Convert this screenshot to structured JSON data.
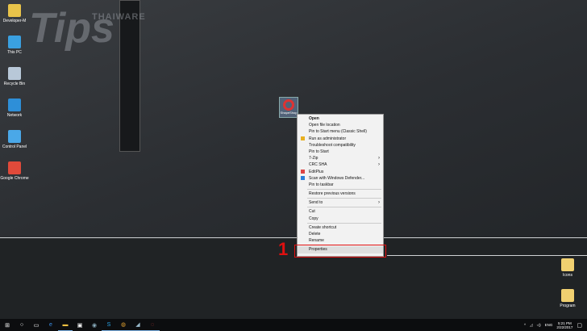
{
  "watermark": {
    "brand": "THAIWARE",
    "word": "Tips"
  },
  "desktop_icons": [
    {
      "label": "Developer-M",
      "color": "#e8c34a"
    },
    {
      "label": "This PC",
      "color": "#3aa0e0"
    },
    {
      "label": "Recycle Bin",
      "color": "#b8c8d8"
    },
    {
      "label": "Network",
      "color": "#2e8fd8"
    },
    {
      "label": "Control Panel",
      "color": "#4aa8e8"
    },
    {
      "label": "Google Chrome",
      "color": "#e04a3a"
    }
  ],
  "right_icons": [
    {
      "label": "Icons"
    },
    {
      "label": "Program"
    }
  ],
  "shortcut": {
    "label": "ShapeShop"
  },
  "menu": {
    "groups": [
      [
        {
          "label": "Open",
          "bold": true
        },
        {
          "label": "Open file location"
        },
        {
          "label": "Pin to Start menu (Classic Shell)"
        },
        {
          "label": "Run as administrator",
          "icon": "shield-icon"
        },
        {
          "label": "Troubleshoot compatibility"
        },
        {
          "label": "Pin to Start"
        },
        {
          "label": "7-Zip",
          "sub": true
        },
        {
          "label": "CRC SHA",
          "sub": true
        },
        {
          "label": "EditPlus",
          "icon": "editplus-icon"
        },
        {
          "label": "Scan with Windows Defender...",
          "icon": "defender-icon"
        },
        {
          "label": "Pin to taskbar"
        }
      ],
      [
        {
          "label": "Restore previous versions"
        }
      ],
      [
        {
          "label": "Send to",
          "sub": true
        }
      ],
      [
        {
          "label": "Cut"
        },
        {
          "label": "Copy"
        }
      ],
      [
        {
          "label": "Create shortcut"
        },
        {
          "label": "Delete"
        },
        {
          "label": "Rename"
        }
      ],
      [
        {
          "label": "Properties",
          "selected": true
        }
      ]
    ]
  },
  "annotation": {
    "number": "1",
    "color": "#e01010"
  },
  "taskbar": {
    "apps": [
      "start",
      "search",
      "task-view",
      "edge",
      "file-explorer",
      "store",
      "app",
      "skype",
      "chrome",
      "app2",
      "app3"
    ],
    "language": "ENG",
    "time": "5:21 PM",
    "date": "2/22/2017"
  }
}
